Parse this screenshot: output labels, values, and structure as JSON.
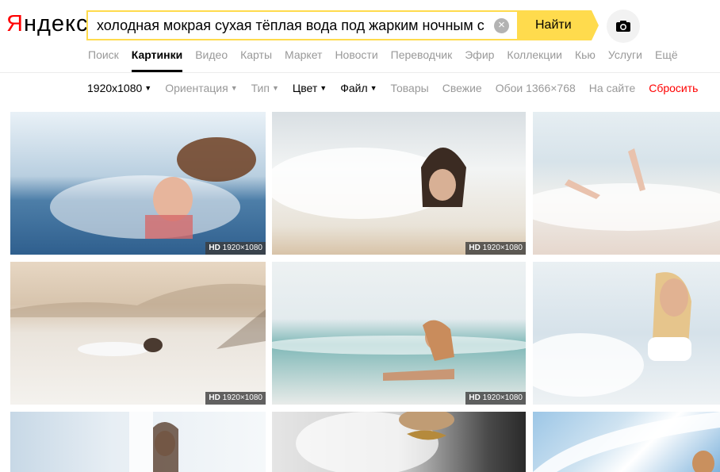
{
  "logo": {
    "first": "Я",
    "rest": "ндекс"
  },
  "search": {
    "query": "холодная мокрая сухая тёплая вода под жарким ночным со",
    "clear": "×",
    "button_label": "Найти"
  },
  "tabs": [
    {
      "label": "Поиск"
    },
    {
      "label": "Картинки",
      "active": true
    },
    {
      "label": "Видео"
    },
    {
      "label": "Карты"
    },
    {
      "label": "Маркет"
    },
    {
      "label": "Новости"
    },
    {
      "label": "Переводчик"
    },
    {
      "label": "Эфир"
    },
    {
      "label": "Коллекции"
    },
    {
      "label": "Кью"
    },
    {
      "label": "Услуги"
    },
    {
      "label": "Ещё"
    }
  ],
  "filters": {
    "size": "1920x1080",
    "orientation": "Ориентация",
    "type": "Тип",
    "color": "Цвет",
    "file": "Файл",
    "goods": "Товары",
    "fresh": "Свежие",
    "wallpapers": "Обои 1366×768",
    "on_site": "На сайте",
    "reset": "Сбросить"
  },
  "results": [
    {
      "hd": "HD",
      "res": "1920×1080"
    },
    {
      "hd": "HD",
      "res": "1920×1080"
    },
    {
      "hd": "HD",
      "res": "1920×1080"
    },
    {
      "hd": "HD",
      "res": "1920×1080"
    }
  ],
  "colors": {
    "accent": "#ffdb4d",
    "reset": "#ff0000",
    "logo_red": "#ff0000"
  }
}
